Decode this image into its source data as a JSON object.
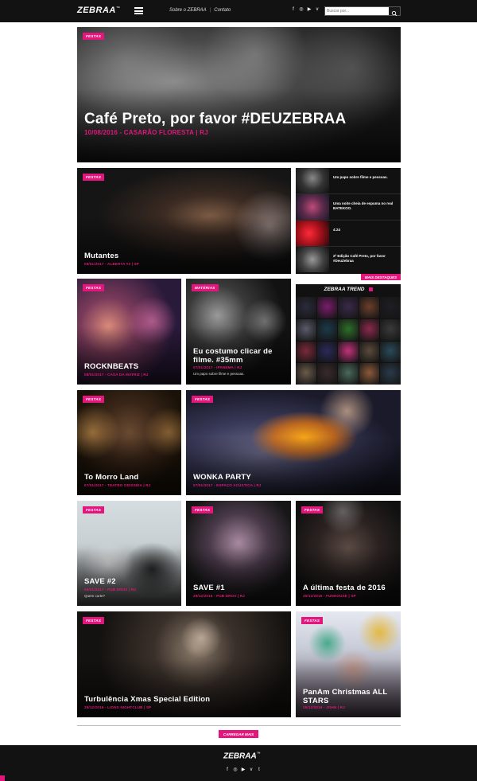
{
  "header": {
    "logo": "ZEBRAA",
    "logo_mark": "™",
    "nav": [
      "Sobre o ZEBRAA",
      "Contato"
    ],
    "nav_separator": "|",
    "social_icons": [
      "facebook-icon",
      "instagram-icon",
      "youtube-icon",
      "vimeo-icon",
      "twitter-icon"
    ],
    "social_glyphs": [
      "f",
      "◎",
      "▶",
      "v",
      "t"
    ],
    "search_placeholder": "Buscar por..."
  },
  "hero": {
    "tag": "FESTAS",
    "title": "Café Preto, por favor #DEUZEBRAA",
    "meta": "10/08/2016 - CASARÃO FLORESTA | RJ"
  },
  "cards": [
    {
      "tag": "FESTAS",
      "title": "Mutantes",
      "meta": "09/01/2017 - ALBERTA #3 | SP",
      "desc": ""
    },
    {
      "tag": "FESTAS",
      "title": "ROCKNBEATS",
      "meta": "08/01/2017 - CASA DA MATRIZ | RJ",
      "desc": ""
    },
    {
      "tag": "MATÉRIAS",
      "title": "Eu costumo clicar de filme. #35mm",
      "meta": "07/01/2017 - IPANEMA | RJ",
      "desc": "Um papo sobre filme e pessoas."
    },
    {
      "tag": "FESTAS",
      "title": "To Morro Land",
      "meta": "07/01/2017 - TEATRO ODISSÉIA | RJ",
      "desc": ""
    },
    {
      "tag": "FESTAS",
      "title": "WONKA PARTY",
      "meta": "07/01/2017 - ESPAÇO ACÚSTICA | RJ",
      "desc": ""
    },
    {
      "tag": "FESTAS",
      "title": "SAVE #2",
      "meta": "06/01/2017 - PUB DROX | RJ",
      "desc": "Quem curte?"
    },
    {
      "tag": "FESTAS",
      "title": "SAVE #1",
      "meta": "29/12/2016 - PUB DROX | RJ",
      "desc": ""
    },
    {
      "tag": "FESTAS",
      "title": "A última festa de 2016",
      "meta": "30/12/2016 - FUNHOUSE | SP",
      "desc": ""
    },
    {
      "tag": "FESTAS",
      "title": "Turbulência Xmas Special Edition",
      "meta": "25/12/2016 - LIONS NIGHTCLUB | SP",
      "desc": ""
    },
    {
      "tag": "FESTAS",
      "title": "PanAm Christmas ALL STARS",
      "meta": "25/12/2016 - JOHN | RJ",
      "desc": ""
    }
  ],
  "sidebar": {
    "items": [
      {
        "text": "Um papo sobre filme e pessoas."
      },
      {
        "text": "Uma noite cheia de espuma no real BATEKOO."
      },
      {
        "text": "4:24"
      },
      {
        "text": "2ª Edição Café Preto, por favor #DeuZebraa"
      }
    ],
    "more_label": "MAIS DESTAQUES"
  },
  "trend": {
    "title": "ZEBRAA TREND",
    "thumb_colors": [
      "#2b2b3c",
      "#7a1d6b",
      "#3a2a4a",
      "#6b3f2a",
      "#1e1e24",
      "#5a5a6a",
      "#1c3a4a",
      "#2e6e2a",
      "#8a2a4a",
      "#3a3a3a",
      "#7a2a3a",
      "#2a2a5a",
      "#c0327a",
      "#5a4a3a",
      "#2a4a5a",
      "#6a5a4a",
      "#3a2a2a",
      "#4a6a5a",
      "#8a5a3a",
      "#2a3a4a"
    ]
  },
  "load_more_label": "CARREGAR MAIS",
  "footer": {
    "logo": "ZEBRAA",
    "logo_mark": "™"
  },
  "colors": {
    "accent": "#e4157d",
    "bar": "#121212"
  }
}
